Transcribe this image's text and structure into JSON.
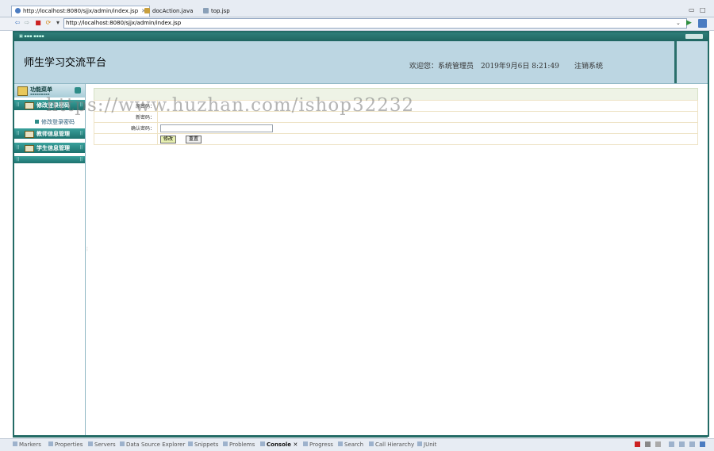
{
  "ide": {
    "tabs": [
      {
        "label": "http://localhost:8080/sjjx/admin/index.jsp",
        "active": true,
        "icon": "globe-icon"
      },
      {
        "label": "docAction.java",
        "active": false,
        "icon": "java-file-icon"
      },
      {
        "label": "top.jsp",
        "active": false,
        "icon": "jsp-file-icon"
      }
    ],
    "close_glyph": "✕"
  },
  "browser": {
    "url": "http://localhost:8080/sjjx/admin/index.jsp"
  },
  "header": {
    "title": "师生学习交流平台",
    "welcome": "欢迎您：系统管理员　2019年9月6日 8:21:49",
    "logout": "注销系统"
  },
  "sidebar": {
    "menu_title": "功能菜单",
    "groups": [
      {
        "label": "修改登录密码",
        "icon": "key-icon"
      },
      {
        "label": "教师信息管理",
        "icon": "folder-icon"
      },
      {
        "label": "学生信息管理",
        "icon": "folder-icon"
      }
    ],
    "sub_item": "修改登录密码"
  },
  "form": {
    "rows": [
      {
        "label": "原密码："
      },
      {
        "label": "新密码："
      },
      {
        "label": "确认密码："
      }
    ],
    "submit_label": "修改",
    "reset_label": "重置"
  },
  "watermark": "https://www.huzhan.com/ishop32232",
  "bottom_tabs": [
    {
      "label": "Markers",
      "active": false
    },
    {
      "label": "Properties",
      "active": false
    },
    {
      "label": "Servers",
      "active": false
    },
    {
      "label": "Data Source Explorer",
      "active": false
    },
    {
      "label": "Snippets",
      "active": false
    },
    {
      "label": "Problems",
      "active": false
    },
    {
      "label": "Console",
      "active": true
    },
    {
      "label": "Progress",
      "active": false
    },
    {
      "label": "Search",
      "active": false
    },
    {
      "label": "Call Hierarchy",
      "active": false
    },
    {
      "label": "JUnit",
      "active": false
    }
  ],
  "colors": {
    "frame": "#236b66",
    "header_bg": "#bcd6e2",
    "menu_group": "#2a8b86",
    "console_stop": "#cc2222"
  }
}
